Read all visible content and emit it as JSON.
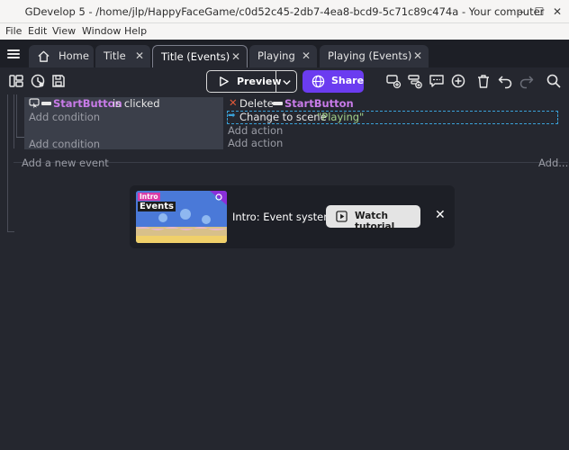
{
  "window": {
    "title": "GDevelop 5 - /home/jlp/HappyFaceGame/c0d52c45-2db7-4ea8-bcd9-5c71c89c474a - Your computer",
    "minimize_glyph": "–",
    "maximize_glyph": "☐",
    "close_glyph": "✕"
  },
  "menu": {
    "items": [
      "File",
      "Edit",
      "View",
      "Window",
      "Help"
    ]
  },
  "tabs": [
    {
      "label": "Home",
      "icon": "home-icon"
    },
    {
      "label": "Title",
      "close": "✕"
    },
    {
      "label": "Title (Events)",
      "close": "✕",
      "active": true
    },
    {
      "label": "Playing",
      "close": "✕"
    },
    {
      "label": "Playing (Events)",
      "close": "✕"
    }
  ],
  "toolbar": {
    "preview_label": "Preview",
    "share_label": "Share",
    "left_icons": [
      "panels-icon",
      "history-icon",
      "save-icon"
    ],
    "right_icons": [
      "add-event-icon",
      "add-subevent-icon",
      "add-comment-icon",
      "add-icon",
      "delete-icon",
      "undo-icon",
      "redo-icon",
      "search-icon"
    ]
  },
  "events": {
    "condition": {
      "object": "StartButton",
      "text": "is clicked"
    },
    "add_condition": "Add condition",
    "add_condition_2": "Add condition",
    "actions": [
      {
        "prefix": "Delete",
        "object": "StartButton"
      },
      {
        "prefix": "Change to scene",
        "value": "\"Playing\""
      }
    ],
    "add_action": "Add action",
    "add_action_2": "Add action",
    "add_new_event": "Add a new event",
    "add_more": "Add..."
  },
  "tutorial": {
    "thumb_badge": "Intro",
    "thumb_title": "Events",
    "title": "Intro: Event system",
    "watch_label": "Watch tutorial",
    "close_glyph": "✕"
  },
  "colors": {
    "accent": "#6b3cf0",
    "object_name": "#c87be8",
    "string_value": "#a4d38c",
    "background": "#25272f"
  }
}
